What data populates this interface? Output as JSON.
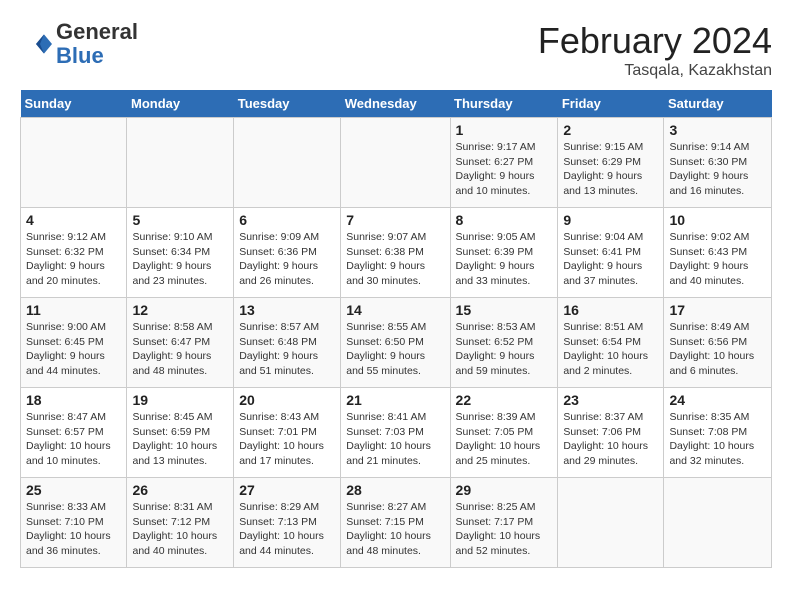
{
  "header": {
    "logo_line1": "General",
    "logo_line2": "Blue",
    "main_title": "February 2024",
    "subtitle": "Tasqala, Kazakhstan"
  },
  "days_of_week": [
    "Sunday",
    "Monday",
    "Tuesday",
    "Wednesday",
    "Thursday",
    "Friday",
    "Saturday"
  ],
  "weeks": [
    [
      {
        "day": "",
        "info": ""
      },
      {
        "day": "",
        "info": ""
      },
      {
        "day": "",
        "info": ""
      },
      {
        "day": "",
        "info": ""
      },
      {
        "day": "1",
        "info": "Sunrise: 9:17 AM\nSunset: 6:27 PM\nDaylight: 9 hours\nand 10 minutes."
      },
      {
        "day": "2",
        "info": "Sunrise: 9:15 AM\nSunset: 6:29 PM\nDaylight: 9 hours\nand 13 minutes."
      },
      {
        "day": "3",
        "info": "Sunrise: 9:14 AM\nSunset: 6:30 PM\nDaylight: 9 hours\nand 16 minutes."
      }
    ],
    [
      {
        "day": "4",
        "info": "Sunrise: 9:12 AM\nSunset: 6:32 PM\nDaylight: 9 hours\nand 20 minutes."
      },
      {
        "day": "5",
        "info": "Sunrise: 9:10 AM\nSunset: 6:34 PM\nDaylight: 9 hours\nand 23 minutes."
      },
      {
        "day": "6",
        "info": "Sunrise: 9:09 AM\nSunset: 6:36 PM\nDaylight: 9 hours\nand 26 minutes."
      },
      {
        "day": "7",
        "info": "Sunrise: 9:07 AM\nSunset: 6:38 PM\nDaylight: 9 hours\nand 30 minutes."
      },
      {
        "day": "8",
        "info": "Sunrise: 9:05 AM\nSunset: 6:39 PM\nDaylight: 9 hours\nand 33 minutes."
      },
      {
        "day": "9",
        "info": "Sunrise: 9:04 AM\nSunset: 6:41 PM\nDaylight: 9 hours\nand 37 minutes."
      },
      {
        "day": "10",
        "info": "Sunrise: 9:02 AM\nSunset: 6:43 PM\nDaylight: 9 hours\nand 40 minutes."
      }
    ],
    [
      {
        "day": "11",
        "info": "Sunrise: 9:00 AM\nSunset: 6:45 PM\nDaylight: 9 hours\nand 44 minutes."
      },
      {
        "day": "12",
        "info": "Sunrise: 8:58 AM\nSunset: 6:47 PM\nDaylight: 9 hours\nand 48 minutes."
      },
      {
        "day": "13",
        "info": "Sunrise: 8:57 AM\nSunset: 6:48 PM\nDaylight: 9 hours\nand 51 minutes."
      },
      {
        "day": "14",
        "info": "Sunrise: 8:55 AM\nSunset: 6:50 PM\nDaylight: 9 hours\nand 55 minutes."
      },
      {
        "day": "15",
        "info": "Sunrise: 8:53 AM\nSunset: 6:52 PM\nDaylight: 9 hours\nand 59 minutes."
      },
      {
        "day": "16",
        "info": "Sunrise: 8:51 AM\nSunset: 6:54 PM\nDaylight: 10 hours\nand 2 minutes."
      },
      {
        "day": "17",
        "info": "Sunrise: 8:49 AM\nSunset: 6:56 PM\nDaylight: 10 hours\nand 6 minutes."
      }
    ],
    [
      {
        "day": "18",
        "info": "Sunrise: 8:47 AM\nSunset: 6:57 PM\nDaylight: 10 hours\nand 10 minutes."
      },
      {
        "day": "19",
        "info": "Sunrise: 8:45 AM\nSunset: 6:59 PM\nDaylight: 10 hours\nand 13 minutes."
      },
      {
        "day": "20",
        "info": "Sunrise: 8:43 AM\nSunset: 7:01 PM\nDaylight: 10 hours\nand 17 minutes."
      },
      {
        "day": "21",
        "info": "Sunrise: 8:41 AM\nSunset: 7:03 PM\nDaylight: 10 hours\nand 21 minutes."
      },
      {
        "day": "22",
        "info": "Sunrise: 8:39 AM\nSunset: 7:05 PM\nDaylight: 10 hours\nand 25 minutes."
      },
      {
        "day": "23",
        "info": "Sunrise: 8:37 AM\nSunset: 7:06 PM\nDaylight: 10 hours\nand 29 minutes."
      },
      {
        "day": "24",
        "info": "Sunrise: 8:35 AM\nSunset: 7:08 PM\nDaylight: 10 hours\nand 32 minutes."
      }
    ],
    [
      {
        "day": "25",
        "info": "Sunrise: 8:33 AM\nSunset: 7:10 PM\nDaylight: 10 hours\nand 36 minutes."
      },
      {
        "day": "26",
        "info": "Sunrise: 8:31 AM\nSunset: 7:12 PM\nDaylight: 10 hours\nand 40 minutes."
      },
      {
        "day": "27",
        "info": "Sunrise: 8:29 AM\nSunset: 7:13 PM\nDaylight: 10 hours\nand 44 minutes."
      },
      {
        "day": "28",
        "info": "Sunrise: 8:27 AM\nSunset: 7:15 PM\nDaylight: 10 hours\nand 48 minutes."
      },
      {
        "day": "29",
        "info": "Sunrise: 8:25 AM\nSunset: 7:17 PM\nDaylight: 10 hours\nand 52 minutes."
      },
      {
        "day": "",
        "info": ""
      },
      {
        "day": "",
        "info": ""
      }
    ]
  ]
}
